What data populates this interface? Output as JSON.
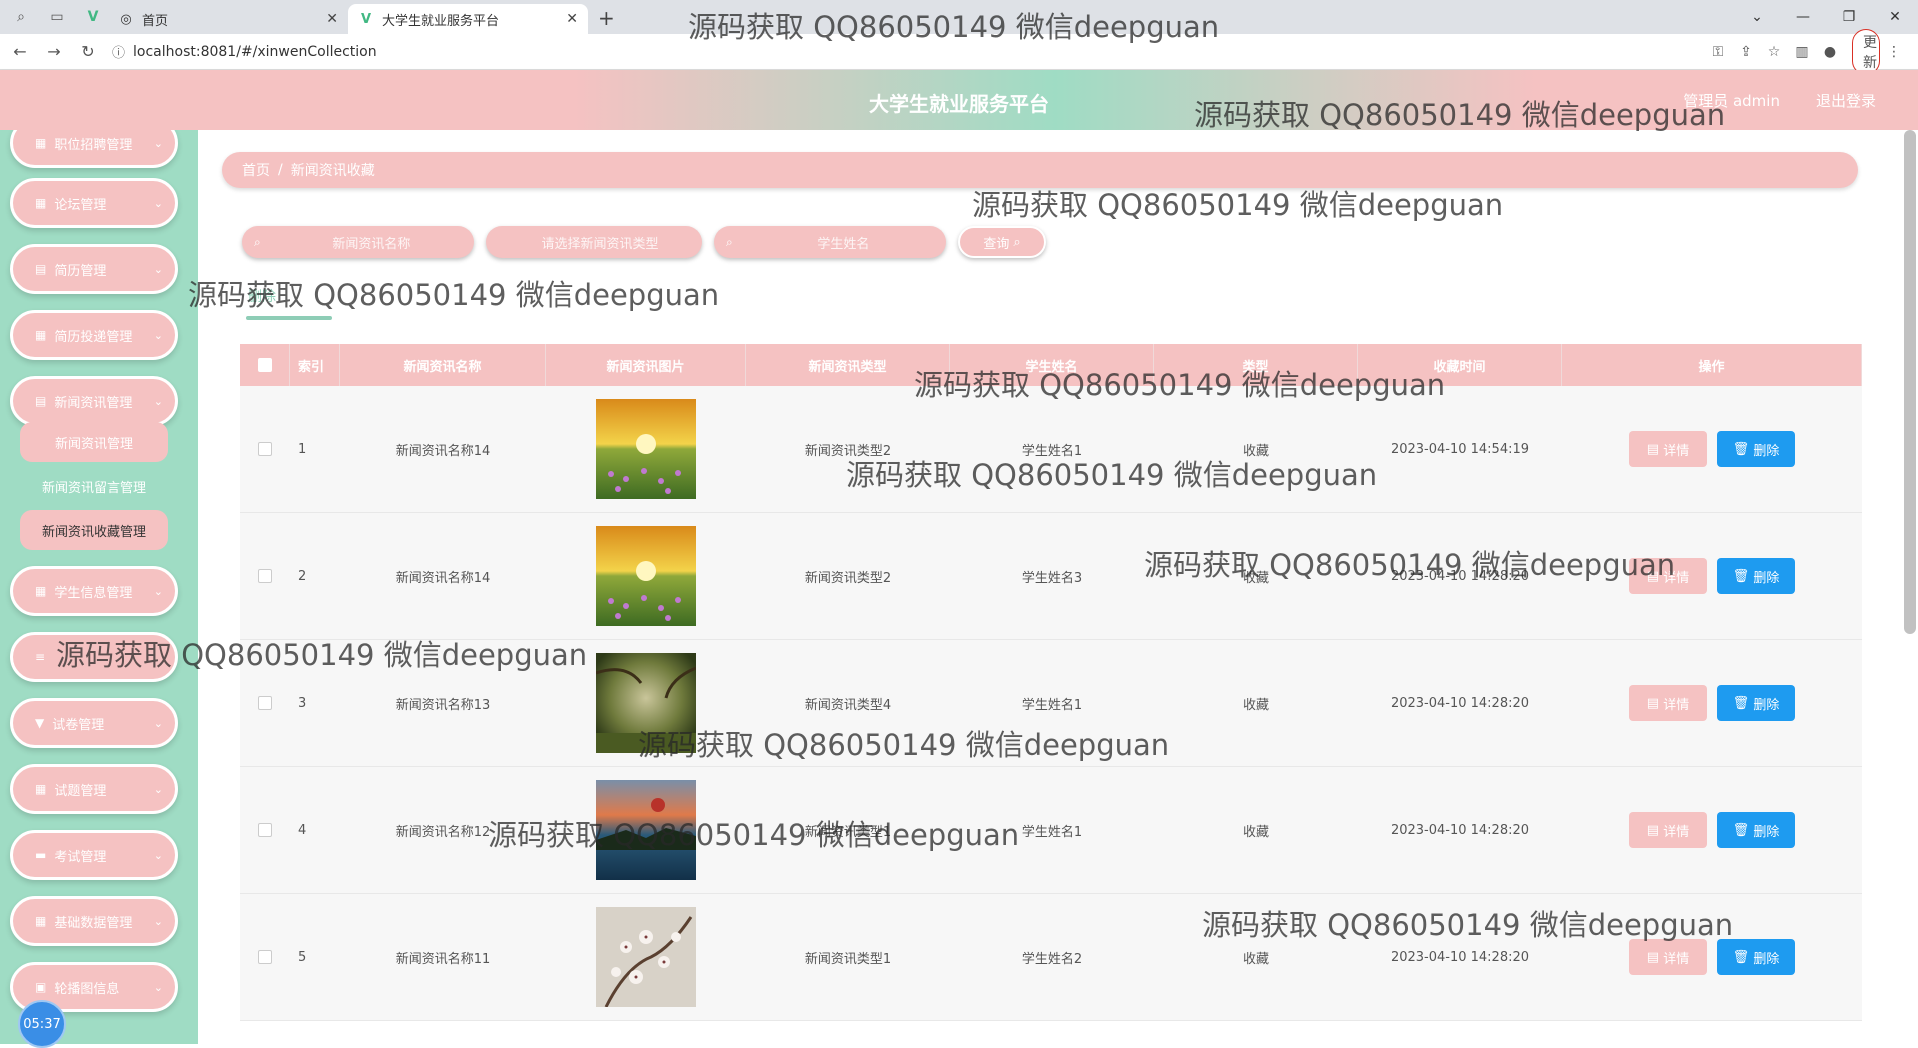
{
  "browser": {
    "tabs": [
      {
        "label": "首页"
      },
      {
        "label": "大学生就业服务平台"
      }
    ],
    "url": "localhost:8081/#/xinwenCollection",
    "update_label": "更新"
  },
  "header": {
    "title": "大学生就业服务平台",
    "user": "管理员 admin",
    "logout": "退出登录"
  },
  "sidebar": {
    "items": [
      {
        "label": "职位招聘管理"
      },
      {
        "label": "论坛管理"
      },
      {
        "label": "简历管理"
      },
      {
        "label": "简历投递管理"
      },
      {
        "label": "新闻资讯管理"
      },
      {
        "label": "学生信息管理"
      },
      {
        "label": ""
      },
      {
        "label": "试卷管理"
      },
      {
        "label": "试题管理"
      },
      {
        "label": "考试管理"
      },
      {
        "label": "基础数据管理"
      },
      {
        "label": "轮播图信息"
      }
    ],
    "submenu": [
      {
        "label": "新闻资讯管理"
      },
      {
        "label": "新闻资讯留言管理"
      },
      {
        "label": "新闻资讯收藏管理"
      }
    ],
    "time": "05:37"
  },
  "breadcrumb": {
    "home": "首页",
    "sep": "/",
    "current": "新闻资讯收藏"
  },
  "search": {
    "name_placeholder": "新闻资讯名称",
    "type_placeholder": "请选择新闻资讯类型",
    "student_placeholder": "学生姓名",
    "button": "查询"
  },
  "batch_delete": "删除",
  "table": {
    "headers": [
      "索引",
      "新闻资讯名称",
      "新闻资讯图片",
      "新闻资讯类型",
      "学生姓名",
      "类型",
      "收藏时间",
      "操作"
    ],
    "rows": [
      {
        "index": "1",
        "name": "新闻资讯名称14",
        "type": "新闻资讯类型2",
        "student": "学生姓名1",
        "status": "收藏",
        "time": "2023-04-10 14:54:19"
      },
      {
        "index": "2",
        "name": "新闻资讯名称14",
        "type": "新闻资讯类型2",
        "student": "学生姓名3",
        "status": "收藏",
        "time": "2023-04-10 14:28:20"
      },
      {
        "index": "3",
        "name": "新闻资讯名称13",
        "type": "新闻资讯类型4",
        "student": "学生姓名1",
        "status": "收藏",
        "time": "2023-04-10 14:28:20"
      },
      {
        "index": "4",
        "name": "新闻资讯名称12",
        "type": "新闻资讯类型1",
        "student": "学生姓名1",
        "status": "收藏",
        "time": "2023-04-10 14:28:20"
      },
      {
        "index": "5",
        "name": "新闻资讯名称11",
        "type": "新闻资讯类型1",
        "student": "学生姓名2",
        "status": "收藏",
        "time": "2023-04-10 14:28:20"
      }
    ],
    "detail_label": "详情",
    "delete_label": "删除"
  },
  "watermark": "源码获取 QQ86050149 微信deepguan",
  "colors": {
    "pink": "#f5c2c2",
    "mint": "#9fdcc4",
    "blue": "#1e9bf0"
  }
}
